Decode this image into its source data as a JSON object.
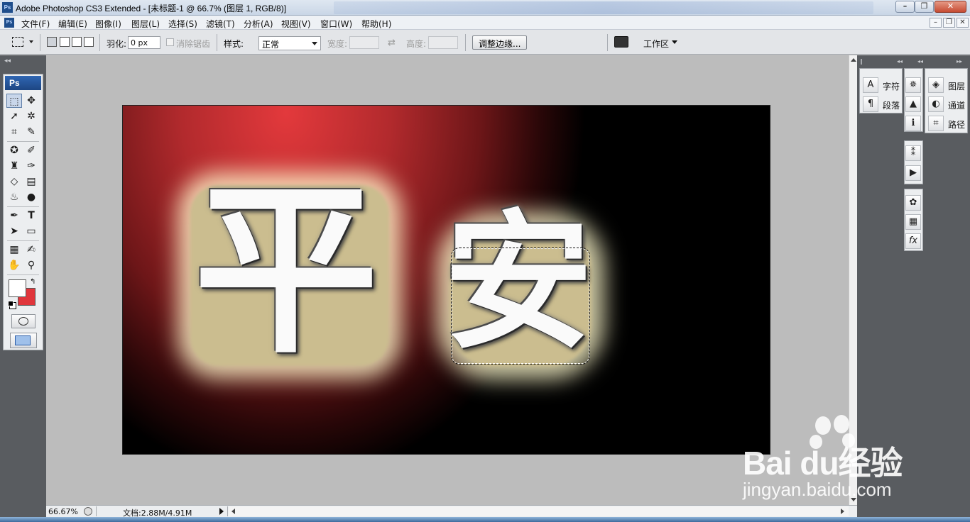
{
  "window": {
    "title": "Adobe Photoshop CS3 Extended - [未标题-1 @ 66.7% (图层 1, RGB/8)]",
    "app_icon": "Ps",
    "minimize": "–",
    "restore": "❐",
    "close": "✕"
  },
  "menubar": {
    "items": [
      "文件(F)",
      "编辑(E)",
      "图像(I)",
      "图层(L)",
      "选择(S)",
      "滤镜(T)",
      "分析(A)",
      "视图(V)",
      "窗口(W)",
      "帮助(H)"
    ],
    "doc_minimize": "–",
    "doc_restore": "❐",
    "doc_close": "✕"
  },
  "options": {
    "feather_label": "羽化:",
    "feather_value": "0 px",
    "antialias_label": "消除锯齿",
    "style_label": "样式:",
    "style_value": "正常",
    "width_label": "宽度:",
    "height_label": "高度:",
    "refine_edge_label": "调整边缘...",
    "workspace_label": "工作区"
  },
  "toolbox": {
    "header": "Ps"
  },
  "canvas": {
    "char_left": "平",
    "char_right": "安",
    "bg_colors": [
      "#e3393c",
      "#6d1618",
      "#000000"
    ]
  },
  "status": {
    "zoom": "66.67%",
    "doc_info": "文档:2.88M/4.91M"
  },
  "panels": {
    "group1": [
      {
        "icon": "A",
        "label": "字符"
      },
      {
        "icon": "¶",
        "label": "段落"
      }
    ],
    "group3": [
      {
        "icon": "◈",
        "label": "图层"
      },
      {
        "icon": "◐",
        "label": "通道"
      },
      {
        "icon": "⌗",
        "label": "路径"
      }
    ]
  },
  "watermark": {
    "brand": "Bai du经验",
    "url": "jingyan.baidu.com"
  }
}
